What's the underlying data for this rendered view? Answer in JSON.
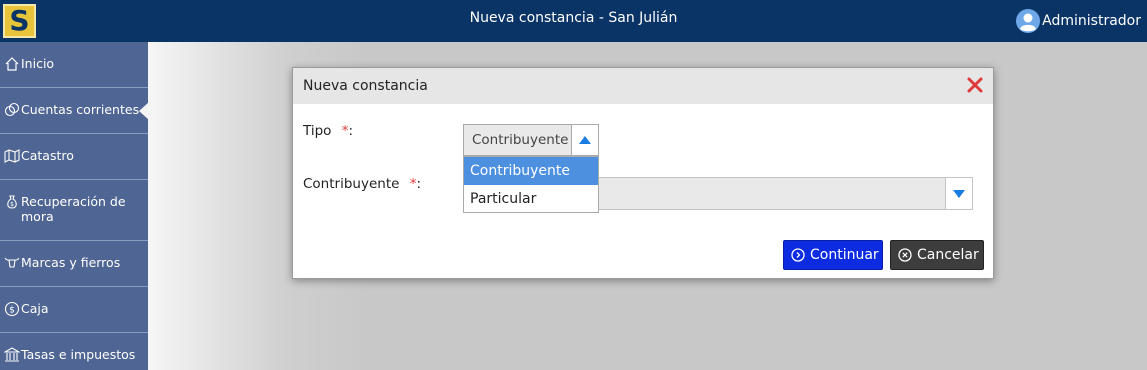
{
  "header": {
    "logo_letter": "S",
    "title": "Nueva constancia - San Julián",
    "user_name": "Administrador"
  },
  "sidebar": {
    "items": [
      {
        "label": "Inicio",
        "icon": "home-icon"
      },
      {
        "label": "Cuentas corrientes",
        "icon": "coins-icon",
        "active": true
      },
      {
        "label": "Catastro",
        "icon": "map-icon"
      },
      {
        "label": "Recuperación de mora",
        "icon": "money-bag-icon"
      },
      {
        "label": "Marcas y fierros",
        "icon": "cattle-icon"
      },
      {
        "label": "Caja",
        "icon": "dollar-icon"
      },
      {
        "label": "Tasas e impuestos",
        "icon": "bank-icon"
      }
    ]
  },
  "modal": {
    "title": "Nueva constancia",
    "tipo_label": "Tipo",
    "tipo_selected": "Contribuyente",
    "tipo_options": [
      "Contribuyente",
      "Particular"
    ],
    "contribuyente_label": "Contribuyente",
    "required_mark": "*",
    "label_suffix": ":",
    "continue_label": "Continuar",
    "cancel_label": "Cancelar"
  },
  "colors": {
    "topbar": "#0a3366",
    "sidebar": "#4f6593",
    "primary_button": "#0d2be0",
    "secondary_button": "#3d3d3d",
    "close_icon": "#e03a3a",
    "selected_option": "#4d90e0"
  }
}
